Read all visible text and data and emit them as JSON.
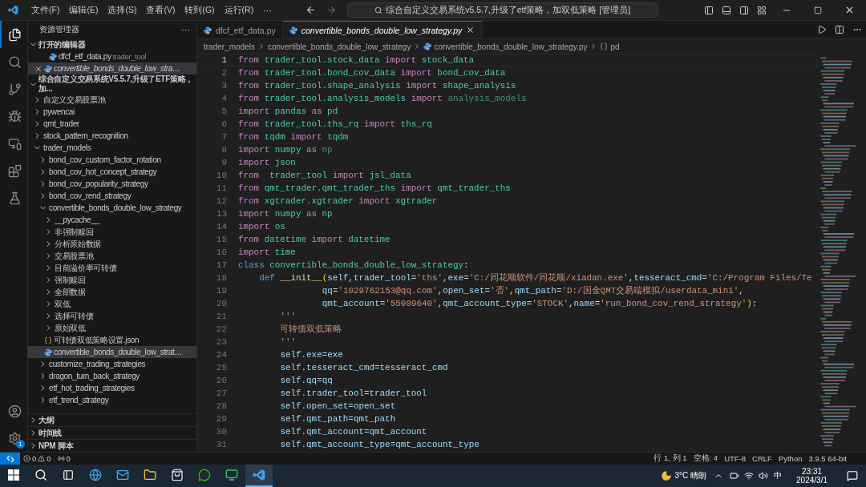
{
  "title_bar": {
    "menus": [
      "文件(F)",
      "编辑(E)",
      "选择(S)",
      "查看(V)",
      "转到(G)",
      "运行(R)"
    ],
    "more": "···",
    "search": "综合自定义交易系统v5.5.7,升级了etf策略，加双低策略 [管理员]"
  },
  "activity_bar": {
    "items": [
      {
        "kind": "files",
        "selected": true
      },
      {
        "kind": "search",
        "selected": false
      },
      {
        "kind": "source-control",
        "selected": false
      },
      {
        "kind": "run-debug",
        "selected": false
      },
      {
        "kind": "remote",
        "selected": false
      },
      {
        "kind": "extensions",
        "selected": false
      },
      {
        "kind": "testing",
        "selected": false
      }
    ],
    "bottom": [
      {
        "kind": "account"
      },
      {
        "kind": "settings",
        "badge": "1"
      }
    ]
  },
  "sidebar": {
    "title": "资源管理器",
    "more": "···",
    "open_editors": {
      "title": "打开的编辑器",
      "expanded": true,
      "items": [
        {
          "name": "dfcf_etf_data.py",
          "description": "trader_tool",
          "selected": false
        },
        {
          "name": "convertible_bonds_double_low_stra…",
          "selected": true
        }
      ]
    },
    "workspace": {
      "title": "综合自定义交易系统V5.5.7,升级了ETF策略，加...",
      "expanded": true,
      "tree": [
        {
          "name": "自定义交易股票池",
          "kind": "folder",
          "expanded": false,
          "selected": false
        },
        {
          "name": "pywencai",
          "kind": "folder",
          "expanded": false,
          "selected": false
        },
        {
          "name": "qmt_trader",
          "kind": "folder",
          "expanded": false,
          "selected": false
        },
        {
          "name": "stock_pattern_recognition",
          "kind": "folder",
          "expanded": false,
          "selected": false
        },
        {
          "name": "trader_models",
          "kind": "folder",
          "expanded": true,
          "selected": false,
          "children": [
            {
              "name": "bond_cov_custom_factor_rotation",
              "kind": "folder",
              "expanded": false,
              "selected": false
            },
            {
              "name": "bond_cov_hot_concept_strategy",
              "kind": "folder",
              "expanded": false,
              "selected": false
            },
            {
              "name": "bond_cov_popularity_strategy",
              "kind": "folder",
              "expanded": false,
              "selected": false
            },
            {
              "name": "bond_cov_rend_strategy",
              "kind": "folder",
              "expanded": false,
              "selected": false
            },
            {
              "name": "convertible_bonds_double_low_strategy",
              "kind": "folder",
              "expanded": true,
              "selected": false,
              "children": [
                {
                  "name": "__pycache__",
                  "kind": "folder",
                  "expanded": false,
                  "selected": false
                },
                {
                  "name": "非强制赎回",
                  "kind": "folder",
                  "expanded": false,
                  "selected": false
                },
                {
                  "name": "分析原始数据",
                  "kind": "folder",
                  "expanded": false,
                  "selected": false
                },
                {
                  "name": "交易股票池",
                  "kind": "folder",
                  "expanded": false,
                  "selected": false
                },
                {
                  "name": "目前溢价率可转债",
                  "kind": "folder",
                  "expanded": false,
                  "selected": false
                },
                {
                  "name": "强制赎回",
                  "kind": "folder",
                  "expanded": false,
                  "selected": false
                },
                {
                  "name": "全部数据",
                  "kind": "folder",
                  "expanded": false,
                  "selected": false
                },
                {
                  "name": "双低",
                  "kind": "folder",
                  "expanded": false,
                  "selected": false
                },
                {
                  "name": "选择可转债",
                  "kind": "folder",
                  "expanded": false,
                  "selected": false
                },
                {
                  "name": "原始双低",
                  "kind": "folder",
                  "expanded": false,
                  "selected": false
                },
                {
                  "name": "可转债双低策略设置.json",
                  "kind": "json",
                  "selected": false
                },
                {
                  "name": "convertible_bonds_double_low_strat…",
                  "kind": "python",
                  "selected": true
                }
              ]
            },
            {
              "name": "customize_trading_strategies",
              "kind": "folder",
              "expanded": false,
              "selected": false
            },
            {
              "name": "dragon_turn_back_strategy",
              "kind": "folder",
              "expanded": false,
              "selected": false
            },
            {
              "name": "etf_hot_trading_strategies",
              "kind": "folder",
              "expanded": false,
              "selected": false
            },
            {
              "name": "etf_trend_strategy",
              "kind": "folder",
              "expanded": false,
              "selected": false
            }
          ]
        }
      ]
    },
    "sections": [
      {
        "title": "大纲",
        "expanded": false
      },
      {
        "title": "时间线",
        "expanded": false
      },
      {
        "title": "NPM 脚本",
        "expanded": false
      }
    ]
  },
  "tabs": [
    {
      "label": "dfcf_etf_data.py",
      "selected": false
    },
    {
      "label": "convertible_bonds_double_low_strategy.py",
      "selected": true
    }
  ],
  "breadcrumbs": [
    {
      "label": "trader_models",
      "kind": "folder"
    },
    {
      "label": "convertible_bonds_double_low_strategy",
      "kind": "folder"
    },
    {
      "label": "convertible_bonds_double_low_strategy.py",
      "kind": "python"
    },
    {
      "label": "pd",
      "kind": "symbol"
    }
  ],
  "editor": {
    "lines": [
      {
        "number": "1",
        "active": true,
        "kind": "top",
        "tokens": [
          {
            "t": "from ",
            "kind": "kw"
          },
          {
            "t": "trader_tool.stock_data ",
            "kind": "mod"
          },
          {
            "t": "import ",
            "kind": "kw"
          },
          {
            "t": "stock_data",
            "kind": "mod"
          }
        ]
      },
      {
        "number": "2",
        "active": false,
        "kind": "top",
        "tokens": [
          {
            "t": "from ",
            "kind": "kw"
          },
          {
            "t": "trader_tool.bond_cov_data ",
            "kind": "mod"
          },
          {
            "t": "import ",
            "kind": "kw"
          },
          {
            "t": "bond_cov_data",
            "kind": "mod"
          }
        ]
      },
      {
        "number": "3",
        "active": false,
        "kind": "top",
        "tokens": [
          {
            "t": "from ",
            "kind": "kw"
          },
          {
            "t": "trader_tool.shape_analysis ",
            "kind": "mod"
          },
          {
            "t": "import ",
            "kind": "kw"
          },
          {
            "t": "shape_analysis",
            "kind": "mod"
          }
        ]
      },
      {
        "number": "4",
        "active": false,
        "kind": "top",
        "tokens": [
          {
            "t": "from ",
            "kind": "kw"
          },
          {
            "t": "trader_tool.analysis_models ",
            "kind": "mod"
          },
          {
            "t": "import ",
            "kind": "kw"
          },
          {
            "t": "analysis_models",
            "kind": "dim"
          }
        ]
      },
      {
        "number": "5",
        "active": false,
        "kind": "top",
        "tokens": [
          {
            "t": "import ",
            "kind": "kw"
          },
          {
            "t": "pandas ",
            "kind": "mod"
          },
          {
            "t": "as ",
            "kind": "kw"
          },
          {
            "t": "pd",
            "kind": "mod"
          }
        ]
      },
      {
        "number": "6",
        "active": false,
        "kind": "top",
        "tokens": [
          {
            "t": "from ",
            "kind": "kw"
          },
          {
            "t": "trader_tool.ths_rq ",
            "kind": "mod"
          },
          {
            "t": "import ",
            "kind": "kw"
          },
          {
            "t": "ths_rq",
            "kind": "mod"
          }
        ]
      },
      {
        "number": "7",
        "active": false,
        "kind": "top",
        "tokens": [
          {
            "t": "from ",
            "kind": "kw"
          },
          {
            "t": "tqdm ",
            "kind": "mod"
          },
          {
            "t": "import ",
            "kind": "kw"
          },
          {
            "t": "tqdm",
            "kind": "mod"
          }
        ]
      },
      {
        "number": "8",
        "active": false,
        "kind": "top",
        "tokens": [
          {
            "t": "import ",
            "kind": "kw"
          },
          {
            "t": "numpy ",
            "kind": "mod"
          },
          {
            "t": "as ",
            "kind": "kw"
          },
          {
            "t": "np",
            "kind": "dim"
          }
        ]
      },
      {
        "number": "9",
        "active": false,
        "kind": "top",
        "tokens": [
          {
            "t": "import ",
            "kind": "kw"
          },
          {
            "t": "json",
            "kind": "mod"
          }
        ]
      },
      {
        "number": "10",
        "active": false,
        "kind": "top",
        "tokens": [
          {
            "t": "from  ",
            "kind": "kw"
          },
          {
            "t": "trader_tool ",
            "kind": "mod"
          },
          {
            "t": "import ",
            "kind": "kw"
          },
          {
            "t": "jsl_data",
            "kind": "mod"
          }
        ]
      },
      {
        "number": "11",
        "active": false,
        "kind": "top",
        "tokens": [
          {
            "t": "from ",
            "kind": "kw"
          },
          {
            "t": "qmt_trader.qmt_trader_ths ",
            "kind": "mod"
          },
          {
            "t": "import ",
            "kind": "kw"
          },
          {
            "t": "qmt_trader_ths",
            "kind": "mod"
          }
        ]
      },
      {
        "number": "12",
        "active": false,
        "kind": "top",
        "tokens": [
          {
            "t": "from ",
            "kind": "kw"
          },
          {
            "t": "xgtrader.xgtrader ",
            "kind": "mod"
          },
          {
            "t": "import ",
            "kind": "kw"
          },
          {
            "t": "xgtrader",
            "kind": "mod"
          }
        ]
      },
      {
        "number": "13",
        "active": false,
        "kind": "top",
        "tokens": [
          {
            "t": "import ",
            "kind": "kw"
          },
          {
            "t": "numpy ",
            "kind": "mod"
          },
          {
            "t": "as ",
            "kind": "kw"
          },
          {
            "t": "np",
            "kind": "mod"
          }
        ]
      },
      {
        "number": "14",
        "active": false,
        "kind": "top",
        "tokens": [
          {
            "t": "import ",
            "kind": "kw"
          },
          {
            "t": "os",
            "kind": "mod"
          }
        ]
      },
      {
        "number": "15",
        "active": false,
        "kind": "top",
        "tokens": [
          {
            "t": "from ",
            "kind": "kw"
          },
          {
            "t": "datetime ",
            "kind": "mod"
          },
          {
            "t": "import ",
            "kind": "kw"
          },
          {
            "t": "datetime",
            "kind": "mod"
          }
        ]
      },
      {
        "number": "16",
        "active": false,
        "kind": "top",
        "tokens": [
          {
            "t": "import ",
            "kind": "kw"
          },
          {
            "t": "time",
            "kind": "mod"
          }
        ]
      },
      {
        "number": "17",
        "active": false,
        "kind": "top",
        "tokens": [
          {
            "t": "class ",
            "kind": "blue"
          },
          {
            "t": "convertible_bonds_double_low_strategy",
            "kind": "mod"
          },
          {
            "t": ":",
            "kind": "punct"
          }
        ]
      },
      {
        "number": "18",
        "active": false,
        "kind": "def",
        "tokens": [
          {
            "t": "def ",
            "kind": "blue"
          },
          {
            "t": "__init__",
            "kind": "fn"
          },
          {
            "t": "(",
            "kind": "paren"
          },
          {
            "t": "self",
            "kind": "var"
          },
          {
            "t": ",",
            "kind": "punct"
          },
          {
            "t": "trader_tool",
            "kind": "var"
          },
          {
            "t": "=",
            "kind": "punct"
          },
          {
            "t": "'ths'",
            "kind": "str"
          },
          {
            "t": ",",
            "kind": "punct"
          },
          {
            "t": "exe",
            "kind": "var"
          },
          {
            "t": "=",
            "kind": "punct"
          },
          {
            "t": "'C:/同花顺软件/同花顺/xiadan.exe'",
            "kind": "str"
          },
          {
            "t": ",",
            "kind": "punct"
          },
          {
            "t": "tesseract_cmd",
            "kind": "var"
          },
          {
            "t": "=",
            "kind": "punct"
          },
          {
            "t": "'C:/Program Files/Te",
            "kind": "str"
          }
        ]
      },
      {
        "number": "19",
        "active": false,
        "kind": "continuation",
        "tokens": [
          {
            "t": "qq",
            "kind": "var"
          },
          {
            "t": "=",
            "kind": "punct"
          },
          {
            "t": "'1029762153@qq.com'",
            "kind": "str"
          },
          {
            "t": ",",
            "kind": "punct"
          },
          {
            "t": "open_set",
            "kind": "var"
          },
          {
            "t": "=",
            "kind": "punct"
          },
          {
            "t": "'否'",
            "kind": "str"
          },
          {
            "t": ",",
            "kind": "punct"
          },
          {
            "t": "qmt_path",
            "kind": "var"
          },
          {
            "t": "=",
            "kind": "punct"
          },
          {
            "t": "'D:/国金QMT交易端模拟/userdata_mini'",
            "kind": "str"
          },
          {
            "t": ",",
            "kind": "punct"
          }
        ]
      },
      {
        "number": "20",
        "active": false,
        "kind": "continuation",
        "tokens": [
          {
            "t": "qmt_account",
            "kind": "var"
          },
          {
            "t": "=",
            "kind": "punct"
          },
          {
            "t": "'55009640'",
            "kind": "str"
          },
          {
            "t": ",",
            "kind": "punct"
          },
          {
            "t": "qmt_account_type",
            "kind": "var"
          },
          {
            "t": "=",
            "kind": "punct"
          },
          {
            "t": "'STOCK'",
            "kind": "str"
          },
          {
            "t": ",",
            "kind": "punct"
          },
          {
            "t": "name",
            "kind": "var"
          },
          {
            "t": "=",
            "kind": "punct"
          },
          {
            "t": "'run_bond_cov_rend_strategy'",
            "kind": "str"
          },
          {
            "t": ")",
            "kind": "paren"
          },
          {
            "t": ":",
            "kind": "punct"
          }
        ]
      },
      {
        "number": "21",
        "active": false,
        "kind": "body",
        "tokens": [
          {
            "t": "'''",
            "kind": "str"
          }
        ]
      },
      {
        "number": "22",
        "active": false,
        "kind": "body",
        "tokens": [
          {
            "t": "可转债双低策略",
            "kind": "str"
          }
        ]
      },
      {
        "number": "23",
        "active": false,
        "kind": "body",
        "tokens": [
          {
            "t": "'''",
            "kind": "str"
          }
        ]
      },
      {
        "number": "24",
        "active": false,
        "kind": "body",
        "tokens": [
          {
            "t": "self.exe=exe",
            "kind": "var"
          }
        ]
      },
      {
        "number": "25",
        "active": false,
        "kind": "body",
        "tokens": [
          {
            "t": "self.tesseract_cmd=tesseract_cmd",
            "kind": "var"
          }
        ]
      },
      {
        "number": "26",
        "active": false,
        "kind": "body",
        "tokens": [
          {
            "t": "self.qq=qq",
            "kind": "var"
          }
        ]
      },
      {
        "number": "27",
        "active": false,
        "kind": "body",
        "tokens": [
          {
            "t": "self.trader_tool=trader_tool",
            "kind": "var"
          }
        ]
      },
      {
        "number": "28",
        "active": false,
        "kind": "body",
        "tokens": [
          {
            "t": "self.open_set=open_set",
            "kind": "var"
          }
        ]
      },
      {
        "number": "29",
        "active": false,
        "kind": "body",
        "tokens": [
          {
            "t": "self.qmt_path=qmt_path",
            "kind": "var"
          }
        ]
      },
      {
        "number": "30",
        "active": false,
        "kind": "body",
        "tokens": [
          {
            "t": "self.qmt_account=qmt_account",
            "kind": "var"
          }
        ]
      },
      {
        "number": "31",
        "active": false,
        "kind": "body",
        "tokens": [
          {
            "t": "self.qmt_account_type=qmt_account_type",
            "kind": "var"
          }
        ]
      }
    ]
  },
  "status_bar": {
    "errors": "0",
    "warnings": "0",
    "ports": "0",
    "position": "行 1, 列 1",
    "items": [
      "空格: 4",
      "UTF-8",
      "CRLF",
      "Python",
      "3.9.5 64-bit"
    ]
  },
  "taskbar": {
    "apps": [
      {
        "kind": "edge",
        "selected": false
      },
      {
        "kind": "mail",
        "selected": false
      },
      {
        "kind": "explorer",
        "selected": false
      },
      {
        "kind": "store",
        "selected": false
      },
      {
        "kind": "wechat",
        "selected": false
      },
      {
        "kind": "monitor",
        "selected": false
      },
      {
        "kind": "vscode",
        "selected": true
      }
    ],
    "weather": "3°C 晴朗",
    "ime": "中",
    "time": "23:31",
    "date": "2024/3/1"
  }
}
